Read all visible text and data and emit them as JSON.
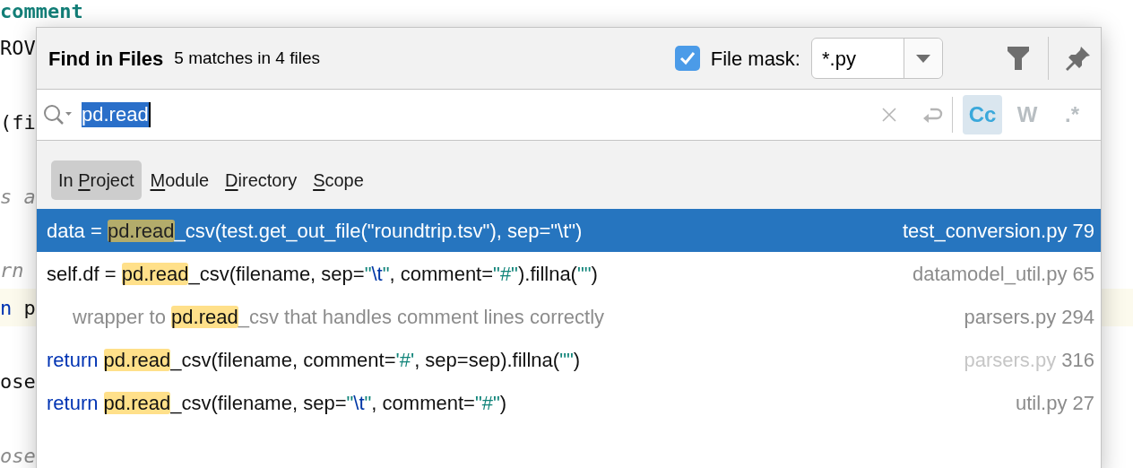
{
  "editor_lines": [
    {
      "kind": "code",
      "segments": [
        {
          "text": "comment",
          "kind": "doc"
        }
      ]
    },
    {
      "kind": "code",
      "segments": [
        {
          "text": "ROV",
          "kind": "plain"
        }
      ]
    },
    {
      "kind": "blank"
    },
    {
      "kind": "code",
      "segments": [
        {
          "text": "(fi",
          "kind": "plain"
        }
      ]
    },
    {
      "kind": "blank"
    },
    {
      "kind": "code",
      "segments": [
        {
          "text": "s a",
          "kind": "comment"
        }
      ]
    },
    {
      "kind": "blank"
    },
    {
      "kind": "code",
      "segments": [
        {
          "text": "rn",
          "kind": "comment"
        }
      ]
    },
    {
      "kind": "code",
      "current": true,
      "segments": [
        {
          "text": "n",
          "kind": "keyword"
        },
        {
          "text": " p",
          "kind": "plain"
        }
      ]
    },
    {
      "kind": "blank"
    },
    {
      "kind": "code",
      "segments": [
        {
          "text": "ose",
          "kind": "plain"
        }
      ]
    },
    {
      "kind": "blank"
    },
    {
      "kind": "code",
      "segments": [
        {
          "text": "ose",
          "kind": "comment"
        }
      ]
    }
  ],
  "dialog": {
    "title": "Find in Files",
    "summary": "5 matches in 4 files",
    "file_mask": {
      "checked": true,
      "label": "File mask:",
      "value": "*.py"
    },
    "search": {
      "value": "pd.read",
      "options": [
        {
          "label": "Cc",
          "selected": true
        },
        {
          "label": "W",
          "selected": false
        },
        {
          "label": ".*",
          "selected": false
        }
      ]
    },
    "scopes": [
      {
        "before": "In ",
        "mnemonic": "P",
        "after": "roject",
        "selected": true
      },
      {
        "mnemonic": "M",
        "after": "odule",
        "selected": false
      },
      {
        "mnemonic": "D",
        "after": "irectory",
        "selected": false
      },
      {
        "mnemonic": "S",
        "after": "cope",
        "selected": false
      }
    ],
    "results": [
      {
        "selected": true,
        "file": "test_conversion.py",
        "line": "79",
        "file_dimmed": false,
        "segments": [
          {
            "text": "data = ",
            "kind": "plain"
          },
          {
            "text": "pd.read",
            "kind": "match"
          },
          {
            "text": "_csv(test.get_out_file(\"roundtrip.tsv\"), sep=\"\\t\")",
            "kind": "plain"
          }
        ]
      },
      {
        "selected": false,
        "file": "datamodel_util.py",
        "line": "65",
        "file_dimmed": false,
        "segments": [
          {
            "text": "self.df = ",
            "kind": "plain"
          },
          {
            "text": "pd.read",
            "kind": "match"
          },
          {
            "text": "_csv(filename, sep=",
            "kind": "plain"
          },
          {
            "text": "\"",
            "kind": "string"
          },
          {
            "text": "\\t",
            "kind": "escape"
          },
          {
            "text": "\"",
            "kind": "string"
          },
          {
            "text": ", comment=",
            "kind": "plain"
          },
          {
            "text": "\"#\"",
            "kind": "string"
          },
          {
            "text": ").fillna(",
            "kind": "plain"
          },
          {
            "text": "\"\"",
            "kind": "string"
          },
          {
            "text": ")",
            "kind": "plain"
          }
        ]
      },
      {
        "selected": false,
        "file": "parsers.py",
        "line": "294",
        "file_dimmed": false,
        "comment": true,
        "segments": [
          {
            "text": "wrapper to ",
            "kind": "comment"
          },
          {
            "text": "pd.read",
            "kind": "match"
          },
          {
            "text": "_csv that handles comment lines correctly",
            "kind": "comment"
          }
        ]
      },
      {
        "selected": false,
        "file": "parsers.py",
        "line": "316",
        "file_dimmed": true,
        "segments": [
          {
            "text": "return ",
            "kind": "keyword"
          },
          {
            "text": "pd.read",
            "kind": "match"
          },
          {
            "text": "_csv(filename, comment=",
            "kind": "plain"
          },
          {
            "text": "'#'",
            "kind": "string"
          },
          {
            "text": ", sep=sep).fillna(",
            "kind": "plain"
          },
          {
            "text": "\"\"",
            "kind": "string"
          },
          {
            "text": ")",
            "kind": "plain"
          }
        ]
      },
      {
        "selected": false,
        "file": "util.py",
        "line": "27",
        "file_dimmed": false,
        "segments": [
          {
            "text": "return ",
            "kind": "keyword"
          },
          {
            "text": "pd.read",
            "kind": "match"
          },
          {
            "text": "_csv(filename, sep=",
            "kind": "plain"
          },
          {
            "text": "\"",
            "kind": "string"
          },
          {
            "text": "\\t",
            "kind": "escape"
          },
          {
            "text": "\"",
            "kind": "string"
          },
          {
            "text": ", comment=",
            "kind": "plain"
          },
          {
            "text": "\"#\"",
            "kind": "string"
          },
          {
            "text": ")",
            "kind": "plain"
          }
        ]
      }
    ]
  }
}
